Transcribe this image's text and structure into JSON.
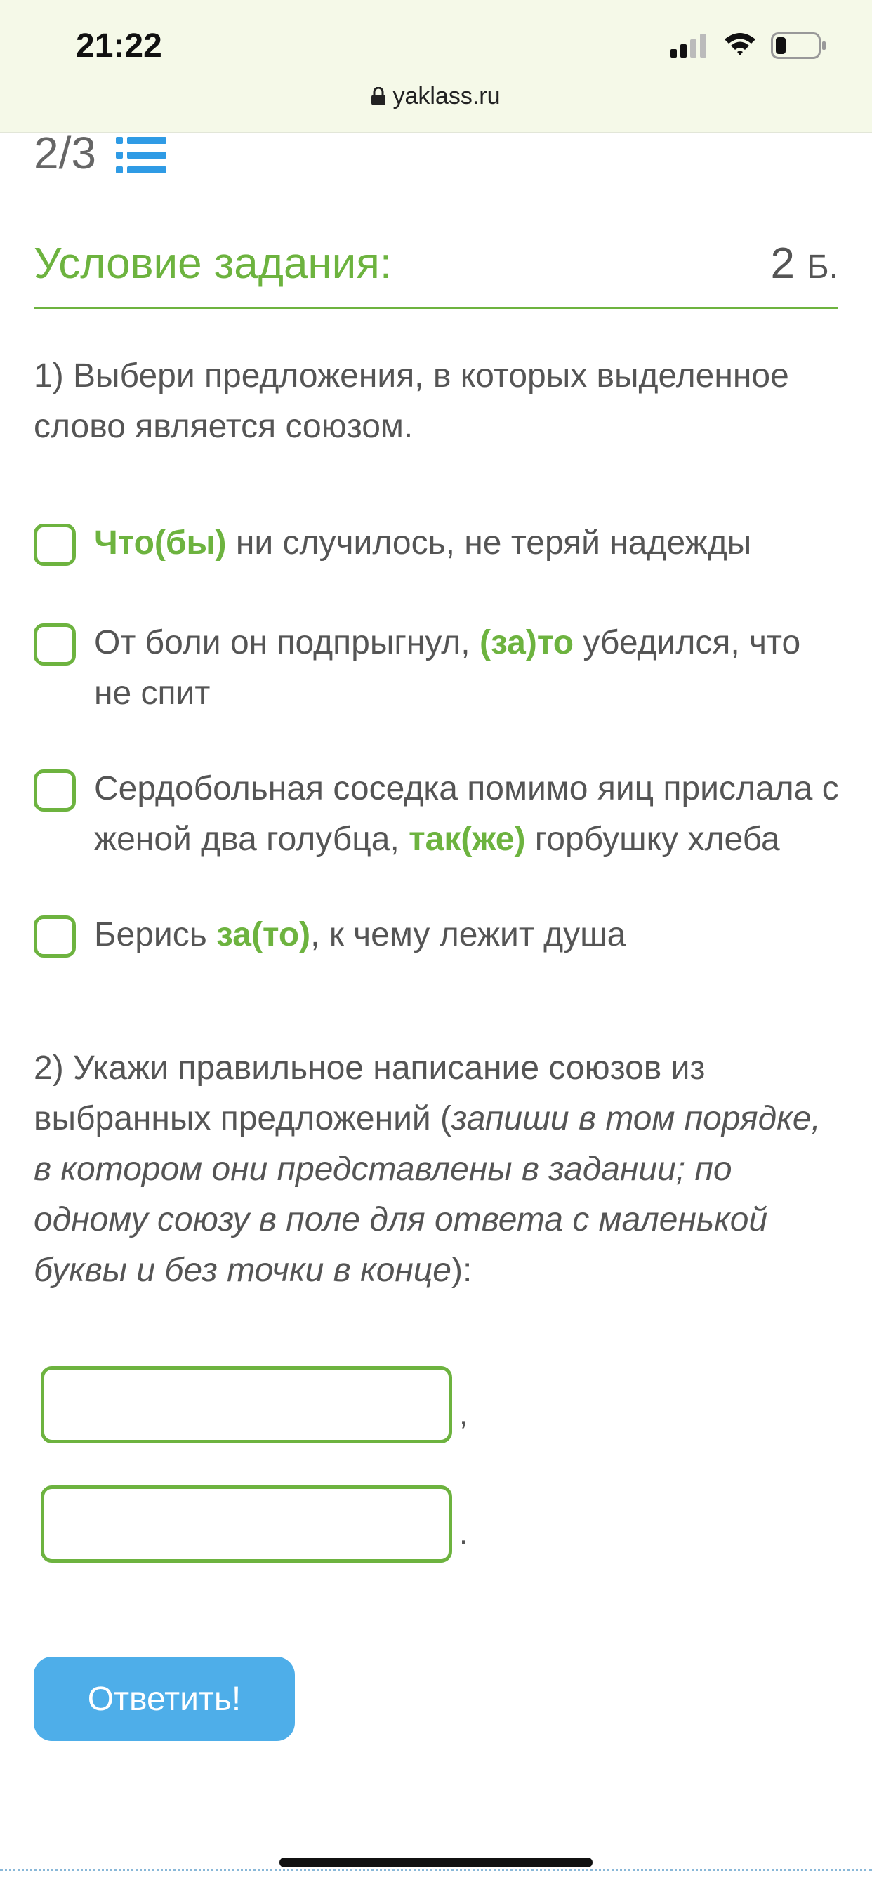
{
  "status_bar": {
    "time": "21:22",
    "url": "yaklass.ru",
    "icons": [
      "signal-icon",
      "wifi-icon",
      "battery-icon",
      "lock-icon"
    ]
  },
  "pager": {
    "text": "2/3",
    "icon": "list-icon"
  },
  "task": {
    "heading": "Условие задания:",
    "points_value": "2",
    "points_unit": "Б."
  },
  "question1": {
    "text": "1) Выбери предложения, в которых выделенное слово является союзом.",
    "options": [
      {
        "highlight": "Что(бы)",
        "after": " ни случилось, не теряй надежды",
        "before": ""
      },
      {
        "before": "От боли он подпрыгнул, ",
        "highlight": "(за)то",
        "after": " убедился, что не спит"
      },
      {
        "before": "Сердобольная соседка помимо яиц прислала с женой два голубца, ",
        "highlight": "так(же)",
        "after": " горбушку хлеба"
      },
      {
        "before": "Берись ",
        "highlight": "за(то)",
        "after": ", к чему лежит душа"
      }
    ]
  },
  "question2": {
    "text_start": "2) Укажи правильное написание союзов из выбранных предложений (",
    "text_italic": "запиши в том порядке, в котором они представлены в задании; по одному союзу в поле для ответа с маленькой буквы и без точки в конце",
    "text_end": "):",
    "answers": [
      {
        "value": "",
        "separator": ","
      },
      {
        "value": "",
        "separator": "."
      }
    ]
  },
  "submit_label": "Ответить!",
  "colors": {
    "accent_green": "#6db33f",
    "button_blue": "#4eaee9",
    "status_bg": "#f5f9e8"
  }
}
